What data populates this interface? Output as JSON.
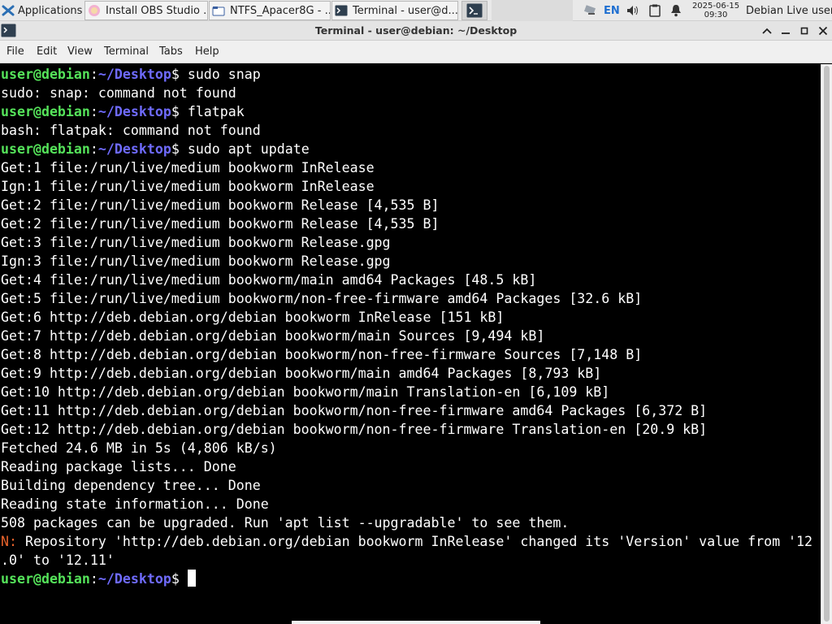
{
  "panel": {
    "applications_label": "Applications",
    "tasks": [
      {
        "label": "Install OBS Studio ...",
        "icon": "browser-icon"
      },
      {
        "label": "NTFS_Apacer8G - ...",
        "icon": "folder-icon"
      },
      {
        "label": "Terminal - user@d...",
        "icon": "terminal-icon"
      }
    ],
    "language": "EN",
    "date": "2025-06-15",
    "time": "09:30",
    "user": "Debian Live user"
  },
  "window": {
    "title": "Terminal - user@debian: ~/Desktop"
  },
  "menu": [
    "File",
    "Edit",
    "View",
    "Terminal",
    "Tabs",
    "Help"
  ],
  "terminal": {
    "prompt_user": "user@debian",
    "prompt_sep": ":",
    "prompt_path": "~/Desktop",
    "prompt_symbol": "$",
    "commands": [
      "sudo snap",
      "flatpak",
      "sudo apt update"
    ],
    "output": [
      "sudo: snap: command not found",
      "bash: flatpak: command not found",
      "Get:1 file:/run/live/medium bookworm InRelease",
      "Ign:1 file:/run/live/medium bookworm InRelease",
      "Get:2 file:/run/live/medium bookworm Release [4,535 B]",
      "Get:2 file:/run/live/medium bookworm Release [4,535 B]",
      "Get:3 file:/run/live/medium bookworm Release.gpg",
      "Ign:3 file:/run/live/medium bookworm Release.gpg",
      "Get:4 file:/run/live/medium bookworm/main amd64 Packages [48.5 kB]",
      "Get:5 file:/run/live/medium bookworm/non-free-firmware amd64 Packages [32.6 kB]",
      "Get:6 http://deb.debian.org/debian bookworm InRelease [151 kB]",
      "Get:7 http://deb.debian.org/debian bookworm/main Sources [9,494 kB]",
      "Get:8 http://deb.debian.org/debian bookworm/non-free-firmware Sources [7,148 B]",
      "Get:9 http://deb.debian.org/debian bookworm/main amd64 Packages [8,793 kB]",
      "Get:10 http://deb.debian.org/debian bookworm/main Translation-en [6,109 kB]",
      "Get:11 http://deb.debian.org/debian bookworm/non-free-firmware amd64 Packages [6,372 B]",
      "Get:12 http://deb.debian.org/debian bookworm/non-free-firmware Translation-en [20.9 kB]",
      "Fetched 24.6 MB in 5s (4,806 kB/s)",
      "Reading package lists... Done",
      "Building dependency tree... Done",
      "Reading state information... Done",
      "508 packages can be upgraded. Run 'apt list --upgradable' to see them."
    ],
    "notice_prefix": "N:",
    "notice_text": " Repository 'http://deb.debian.org/debian bookworm InRelease' changed its 'Version' value from '12",
    "notice_cont": ".0' to '12.11'"
  }
}
